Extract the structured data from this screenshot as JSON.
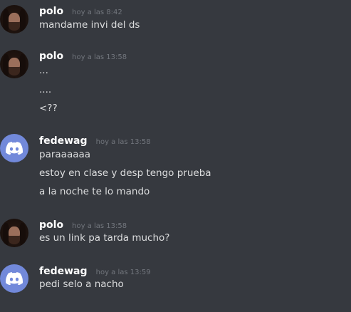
{
  "messages": [
    {
      "author": "polo",
      "time": "hoy a las 8:42",
      "avatar": "photo-avatar",
      "lines": [
        "mandame invi del ds"
      ]
    },
    {
      "author": "polo",
      "time": "hoy a las 13:58",
      "avatar": "photo-avatar",
      "lines": [
        "...",
        "....",
        "<??"
      ]
    },
    {
      "author": "fedewag",
      "time": "hoy a las 13:58",
      "avatar": "discord-logo-avatar",
      "lines": [
        "paraaaaaa",
        "estoy en clase y desp tengo prueba",
        "a la noche te lo mando"
      ]
    },
    {
      "author": "polo",
      "time": "hoy a las 13:58",
      "avatar": "photo-avatar",
      "lines": [
        "es un link pa tarda mucho?"
      ]
    },
    {
      "author": "fedewag",
      "time": "hoy a las 13:59",
      "avatar": "discord-logo-avatar",
      "lines": [
        "pedi selo a nacho"
      ]
    }
  ],
  "colors": {
    "background": "#36393f",
    "username": "#ffffff",
    "timestamp": "#72767d",
    "message": "#dcddde",
    "discord_blurple": "#7289da"
  }
}
